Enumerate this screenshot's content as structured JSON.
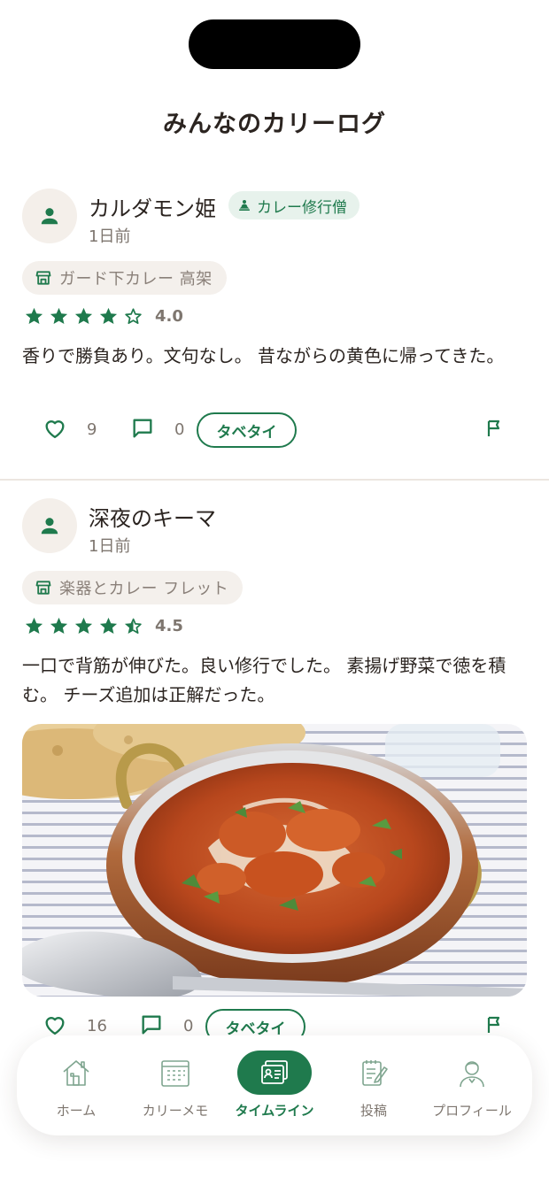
{
  "header": {
    "title": "みんなのカリーログ"
  },
  "posts": [
    {
      "username": "カルダモン姫",
      "rank_badge": "カレー修行僧",
      "timestamp": "1日前",
      "shop": "ガード下カレー 高架",
      "rating": 4.0,
      "rating_label": "4.0",
      "review": "香りで勝負あり。文句なし。 昔ながらの黄色に帰ってきた。",
      "likes": "9",
      "comments": "0",
      "tabetai_label": "タベタイ",
      "has_photo": false
    },
    {
      "username": "深夜のキーマ",
      "timestamp": "1日前",
      "shop": "楽器とカレー フレット",
      "rating": 4.5,
      "rating_label": "4.5",
      "review": "一口で背筋が伸びた。良い修行でした。 素揚げ野菜で徳を積む。 チーズ追加は正解だった。",
      "likes": "16",
      "comments": "0",
      "tabetai_label": "タベタイ",
      "has_photo": true
    }
  ],
  "bottom_nav": {
    "items": [
      {
        "label": "ホーム",
        "icon": "house-icon",
        "active": false
      },
      {
        "label": "カリーメモ",
        "icon": "calendar-icon",
        "active": false
      },
      {
        "label": "タイムライン",
        "icon": "timeline-cards-icon",
        "active": true
      },
      {
        "label": "投稿",
        "icon": "notepad-pen-icon",
        "active": false
      },
      {
        "label": "プロフィール",
        "icon": "person-icon",
        "active": false
      }
    ]
  },
  "colors": {
    "accent": "#1f7a4d",
    "badge_bg": "#e7f2ec",
    "chip_bg": "#f4f0ec",
    "text": "#2b2420",
    "muted": "#7e766f"
  }
}
